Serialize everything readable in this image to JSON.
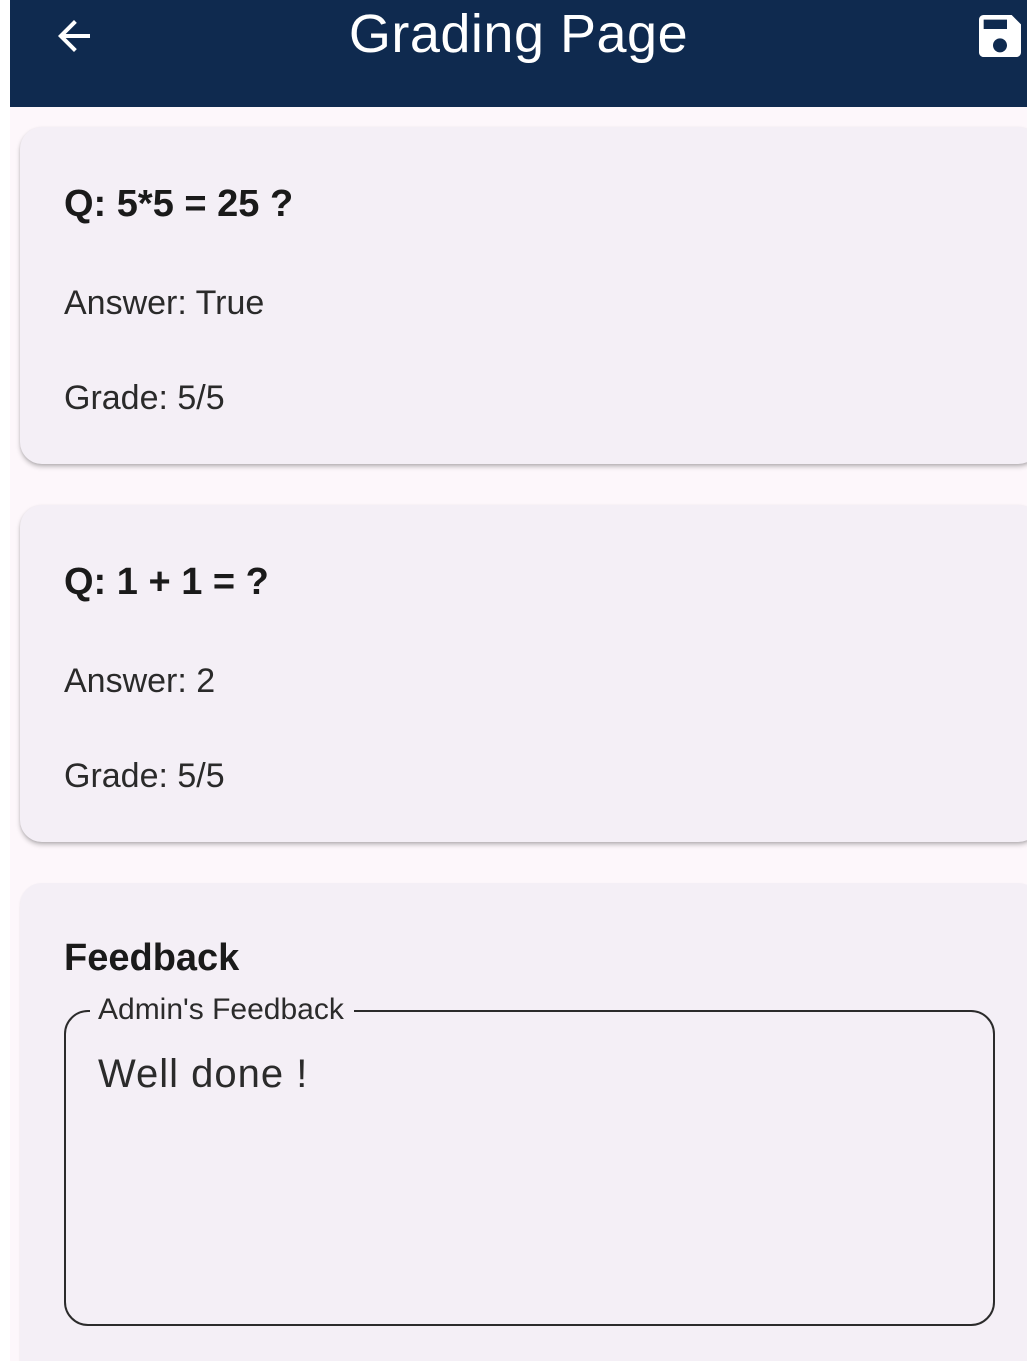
{
  "app_bar": {
    "title": "Grading Page",
    "back_icon": "arrow-back-icon",
    "save_icon": "save-icon",
    "background": "#0f2a4f"
  },
  "questions": [
    {
      "question": "Q: 5*5 = 25 ?",
      "answer": "Answer: True",
      "grade": "Grade: 5/5"
    },
    {
      "question": "Q: 1 + 1 = ?",
      "answer": "Answer: 2",
      "grade": "Grade: 5/5"
    }
  ],
  "feedback": {
    "title": "Feedback",
    "field_label": "Admin's Feedback",
    "value": "Well done !"
  }
}
